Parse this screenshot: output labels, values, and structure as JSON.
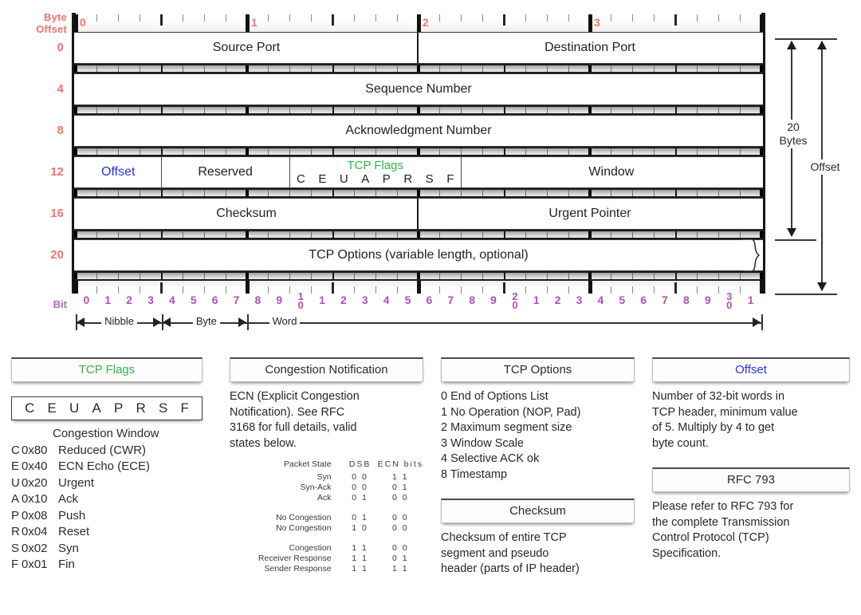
{
  "diagram": {
    "byte_offset_label": "Byte\nOffset",
    "byte_offset_line1": "Byte",
    "byte_offset_line2": "Offset",
    "bit_label": "Bit",
    "byte_offsets": [
      "0",
      "4",
      "8",
      "12",
      "16",
      "20"
    ],
    "top_ruler_numbers": [
      "0",
      "1",
      "2",
      "3"
    ],
    "bit_numbers": [
      "0",
      "1",
      "2",
      "3",
      "4",
      "5",
      "6",
      "7",
      "8",
      "9",
      "10",
      "1",
      "2",
      "3",
      "4",
      "5",
      "6",
      "7",
      "8",
      "9",
      "20",
      "1",
      "2",
      "3",
      "4",
      "5",
      "6",
      "7",
      "8",
      "9",
      "30",
      "1"
    ],
    "rows": [
      {
        "offset": "0",
        "fields": [
          {
            "label": "Source Port"
          },
          {
            "label": "Destination Port"
          }
        ]
      },
      {
        "offset": "4",
        "fields": [
          {
            "label": "Sequence Number"
          }
        ]
      },
      {
        "offset": "8",
        "fields": [
          {
            "label": "Acknowledgment Number"
          }
        ]
      },
      {
        "offset": "12",
        "fields": [
          {
            "label": "Offset"
          },
          {
            "label": "Reserved"
          },
          {
            "label": "TCP Flags"
          },
          {
            "label": "Window"
          }
        ]
      },
      {
        "offset": "16",
        "fields": [
          {
            "label": "Checksum"
          },
          {
            "label": "Urgent Pointer"
          }
        ]
      },
      {
        "offset": "20",
        "fields": [
          {
            "label": "TCP Options (variable length, optional)"
          }
        ]
      }
    ],
    "flag_letters": [
      "C",
      "E",
      "U",
      "A",
      "P",
      "R",
      "S",
      "F"
    ],
    "scale": {
      "nibble": "Nibble",
      "byte": "Byte",
      "word": "Word"
    },
    "annotations": {
      "bytes_line1": "20",
      "bytes_line2": "Bytes",
      "offset": "Offset"
    },
    "colors": {
      "byte_offset": "#f4736b",
      "bit": "#b052b0",
      "offset_field": "#2a32d8",
      "tcp_flags": "#35b44b"
    }
  },
  "legend": {
    "tcp_flags": {
      "title": "TCP Flags",
      "letters": [
        "C",
        "E",
        "U",
        "A",
        "P",
        "R",
        "S",
        "F"
      ],
      "congestion_window_header": "Congestion Window",
      "rows": [
        {
          "key": "C",
          "hex": "0x80",
          "name": "Reduced (CWR)"
        },
        {
          "key": "E",
          "hex": "0x40",
          "name": "ECN Echo (ECE)"
        },
        {
          "key": "U",
          "hex": "0x20",
          "name": "Urgent"
        },
        {
          "key": "A",
          "hex": "0x10",
          "name": "Ack"
        },
        {
          "key": "P",
          "hex": "0x08",
          "name": "Push"
        },
        {
          "key": "R",
          "hex": "0x04",
          "name": "Reset"
        },
        {
          "key": "S",
          "hex": "0x02",
          "name": "Syn"
        },
        {
          "key": "F",
          "hex": "0x01",
          "name": "Fin"
        }
      ]
    },
    "congestion": {
      "title": "Congestion Notification",
      "paragraph_lines": [
        "ECN (Explicit Congestion",
        "Notification).  See RFC",
        "3168 for full details, valid",
        "states below."
      ],
      "table_headers": [
        "Packet State",
        "DSB",
        "ECN bits"
      ],
      "table_rows": [
        {
          "state": "Syn",
          "dsb": "0 0",
          "ecn": "1 1",
          "gap_before": false
        },
        {
          "state": "Syn-Ack",
          "dsb": "0 0",
          "ecn": "0 1",
          "gap_before": false
        },
        {
          "state": "Ack",
          "dsb": "0 1",
          "ecn": "0 0",
          "gap_before": false
        },
        {
          "state": "No Congestion",
          "dsb": "0 1",
          "ecn": "0 0",
          "gap_before": true
        },
        {
          "state": "No Congestion",
          "dsb": "1 0",
          "ecn": "0 0",
          "gap_before": false
        },
        {
          "state": "Congestion",
          "dsb": "1 1",
          "ecn": "0 0",
          "gap_before": true
        },
        {
          "state": "Receiver Response",
          "dsb": "1 1",
          "ecn": "0 1",
          "gap_before": false
        },
        {
          "state": "Sender Response",
          "dsb": "1 1",
          "ecn": "1 1",
          "gap_before": false
        }
      ]
    },
    "tcp_options": {
      "title": "TCP Options",
      "options": [
        {
          "code": "0",
          "name": "End of Options List"
        },
        {
          "code": "1",
          "name": "No Operation (NOP, Pad)"
        },
        {
          "code": "2",
          "name": "Maximum segment size"
        },
        {
          "code": "3",
          "name": "Window Scale"
        },
        {
          "code": "4",
          "name": "Selective ACK ok"
        },
        {
          "code": "8",
          "name": "Timestamp"
        }
      ]
    },
    "checksum": {
      "title": "Checksum",
      "paragraph_lines": [
        "Checksum of entire TCP",
        "segment and pseudo",
        "header (parts of IP header)"
      ]
    },
    "offset": {
      "title": "Offset",
      "paragraph_lines": [
        "Number of 32-bit words in",
        "TCP header, minimum value",
        "of 5.  Multiply by 4 to get",
        "byte count."
      ]
    },
    "rfc": {
      "title": "RFC 793",
      "paragraph_lines": [
        "Please refer to RFC 793 for",
        "the complete Transmission",
        "Control Protocol (TCP)",
        "Specification."
      ]
    }
  }
}
